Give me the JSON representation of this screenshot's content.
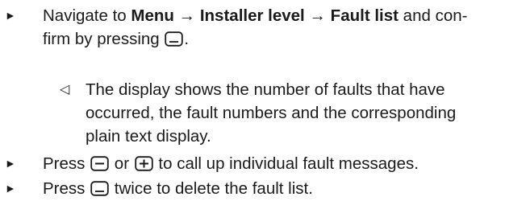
{
  "step1": {
    "bullet": "►",
    "prefix": "Navigate to ",
    "menu": "Menu",
    "arrow1": " → ",
    "installer": "Installer level",
    "arrow2": " → ",
    "faultlist": "Fault list",
    "suffix_line1": " and con-",
    "line2_prefix": "firm by pressing ",
    "line2_suffix": ".",
    "key_icon": "ok-key-icon"
  },
  "result1": {
    "marker": "◁",
    "line1": "The display shows the number of faults that have",
    "line2": "occurred, the fault numbers and the corresponding",
    "line3": "plain text display."
  },
  "step2": {
    "bullet": "►",
    "prefix": "Press ",
    "middle": " or ",
    "suffix": " to call up individual fault messages.",
    "key_icon_minus": "minus-key-icon",
    "key_icon_plus": "plus-key-icon"
  },
  "step3": {
    "bullet": "►",
    "prefix": "Press ",
    "suffix": " twice to delete the fault list.",
    "key_icon": "ok-key-icon"
  }
}
